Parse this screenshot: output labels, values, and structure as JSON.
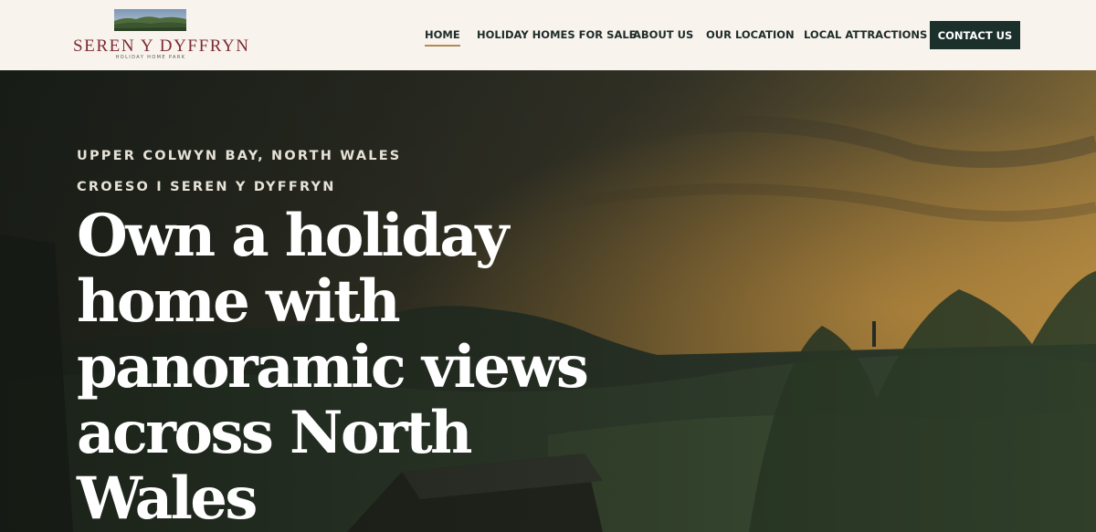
{
  "brand": {
    "name": "SEREN Y DYFFRYN",
    "tagline": "HOLIDAY HOME PARK"
  },
  "nav": {
    "items": [
      {
        "label": "HOME",
        "active": true
      },
      {
        "label": "HOLIDAY HOMES FOR SALE"
      },
      {
        "label": "ABOUT US"
      },
      {
        "label": "OUR LOCATION"
      },
      {
        "label": "LOCAL ATTRACTIONS"
      }
    ],
    "contact_label": "CONTACT US"
  },
  "hero": {
    "eyebrow_1": "UPPER COLWYN BAY, NORTH WALES",
    "eyebrow_2": "CROESO I SEREN Y DYFFRYN",
    "headline": "Own a holiday home with panoramic views across North Wales"
  },
  "colors": {
    "brand_red": "#7d2a32",
    "header_bg": "#f8f4ed",
    "button_bg": "#1b302b",
    "nav_text": "#1d2b28",
    "active_underline": "#b08a57"
  }
}
